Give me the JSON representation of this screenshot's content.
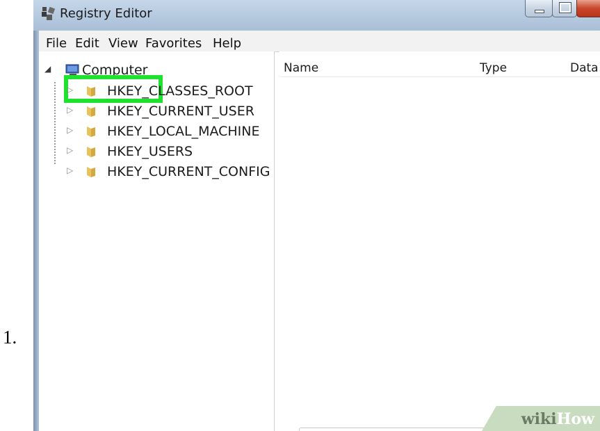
{
  "step": {
    "number": "1."
  },
  "window": {
    "title": "Registry Editor",
    "icon": "registry-editor-icon",
    "controls": [
      "minimize-icon",
      "maximize-icon",
      "close-icon"
    ]
  },
  "menu": {
    "items": [
      "File",
      "Edit",
      "View",
      "Favorites",
      "Help"
    ]
  },
  "tree": {
    "root": {
      "label": "Computer",
      "icon": "computer-icon",
      "expanded": true,
      "highlighted": true
    },
    "children": [
      {
        "label": "HKEY_CLASSES_ROOT",
        "icon": "folder-icon"
      },
      {
        "label": "HKEY_CURRENT_USER",
        "icon": "folder-icon"
      },
      {
        "label": "HKEY_LOCAL_MACHINE",
        "icon": "folder-icon"
      },
      {
        "label": "HKEY_USERS",
        "icon": "folder-icon"
      },
      {
        "label": "HKEY_CURRENT_CONFIG",
        "icon": "folder-icon"
      }
    ]
  },
  "list": {
    "columns": [
      "Name",
      "Type",
      "Data"
    ]
  },
  "colors": {
    "highlight": "#1ee22f",
    "titlebar": "#b4c8de",
    "close_button": "#c9462a"
  },
  "watermark": {
    "part1": "wiki",
    "part2": "How"
  }
}
